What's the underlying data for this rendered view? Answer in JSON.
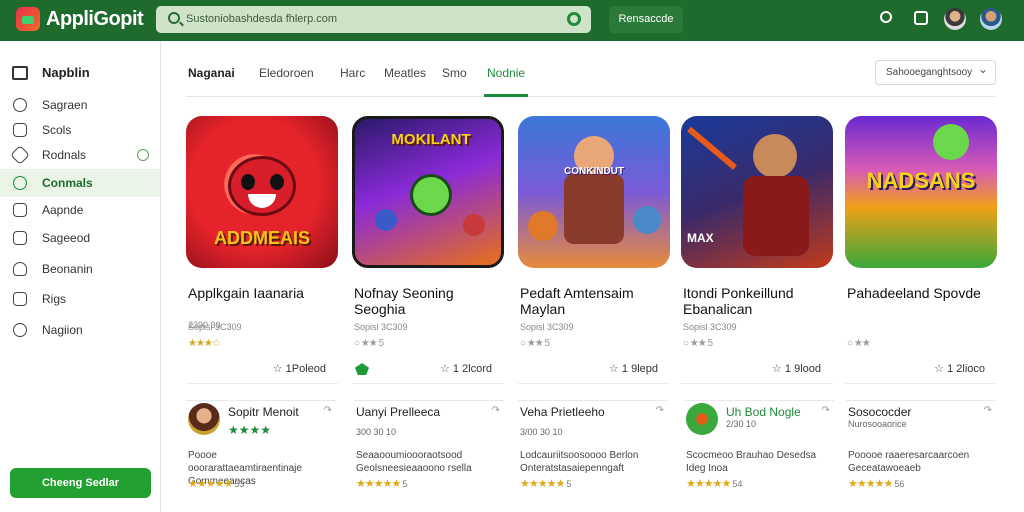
{
  "header": {
    "brand": "AppliGopit",
    "search_placeholder": "Sustoniobashdesda fhlerp.com",
    "action_button": "Rensaccde"
  },
  "sidebar": {
    "heading": "Napblin",
    "items": [
      {
        "label": "Sagraen",
        "icon": "settings-icon"
      },
      {
        "label": "Scols",
        "icon": "clock-icon"
      },
      {
        "label": "Rodnals",
        "icon": "tag-icon"
      },
      {
        "label": "Conmals",
        "icon": "gamepad-icon"
      },
      {
        "label": "Aapnde",
        "icon": "bookmark-icon"
      },
      {
        "label": "Sageeod",
        "icon": "edit-icon"
      },
      {
        "label": "Beonanin",
        "icon": "users-icon"
      },
      {
        "label": "Rigs",
        "icon": "grid-icon"
      },
      {
        "label": "Nagiion",
        "icon": "compass-icon"
      }
    ],
    "active_index": 3,
    "cta": "Cheeng Sedlar"
  },
  "tabs": [
    {
      "label": "Naganai"
    },
    {
      "label": "Eledoroen"
    },
    {
      "label": "Harc"
    },
    {
      "label": "Meatles"
    },
    {
      "label": "Smo"
    },
    {
      "label": "Nodnie"
    }
  ],
  "active_tab": 5,
  "sort_label": "Sahooeganghtsooy",
  "apps": [
    {
      "title": "Applkgain Iaanaria",
      "sub1": "2390 30",
      "sub2": "Sopisl 3C309",
      "downloads": "1Poleod",
      "art_text": "ADDMEAIS",
      "art_colors": [
        "#e5232a",
        "#8a0f18"
      ]
    },
    {
      "title": "Nofnay Seoning Seoghia",
      "sub1": "",
      "sub2": "Sopisl 3C309",
      "downloads": "1 2lcord",
      "art_text": "MOKILANT",
      "art_colors": [
        "#8a2ad8",
        "#e8701a"
      ]
    },
    {
      "title": "Pedaft Amtensaim Maylan",
      "sub1": "",
      "sub2": "Sopisl 3C309",
      "downloads": "1 9lepd",
      "art_text": "CONKINDUT",
      "art_colors": [
        "#3a78d8",
        "#e88a3a"
      ]
    },
    {
      "title": "Itondi Ponkeillund Ebanalican",
      "sub1": "",
      "sub2": "Sopisl 3C309",
      "downloads": "1 9lood",
      "art_text": "MAX",
      "art_colors": [
        "#1a3a9a",
        "#c23a1a"
      ]
    },
    {
      "title": "Pahadeeland Spovde",
      "sub1": "",
      "sub2": "Sopisl 3C309",
      "downloads": "1 2lioco",
      "art_text": "NADSANS",
      "art_colors": [
        "#f0a018",
        "#6a2ad0"
      ]
    }
  ],
  "reviews": [
    {
      "name": "Sopitr Menoit",
      "meta": "",
      "text": "Poooe ooorarattaeamtiraentinaje Gommeeancas",
      "count": "53"
    },
    {
      "name": "Uanyi Prelleeca",
      "meta": "300 30 10",
      "text": "Seaaooumioooraotsood Geolsneesieaaoono rsella",
      "count": "5"
    },
    {
      "name": "Veha Prietleeho",
      "meta": "3/00 30 10",
      "text": "Lodcauriitsoosoooo Berlon Onteratstasaiepenngaft",
      "count": "5"
    },
    {
      "name": "Uh Bod Nogle",
      "meta": "2/30 10",
      "text": "Scocmeoo Brauhao Desedsa Ideg Inoa",
      "count": "54"
    },
    {
      "name": "Sosococder",
      "meta": "Nurosooaorice",
      "text": "Pooooe raaeresarcaarcoen Geceatawoeaeb",
      "count": "56"
    }
  ]
}
